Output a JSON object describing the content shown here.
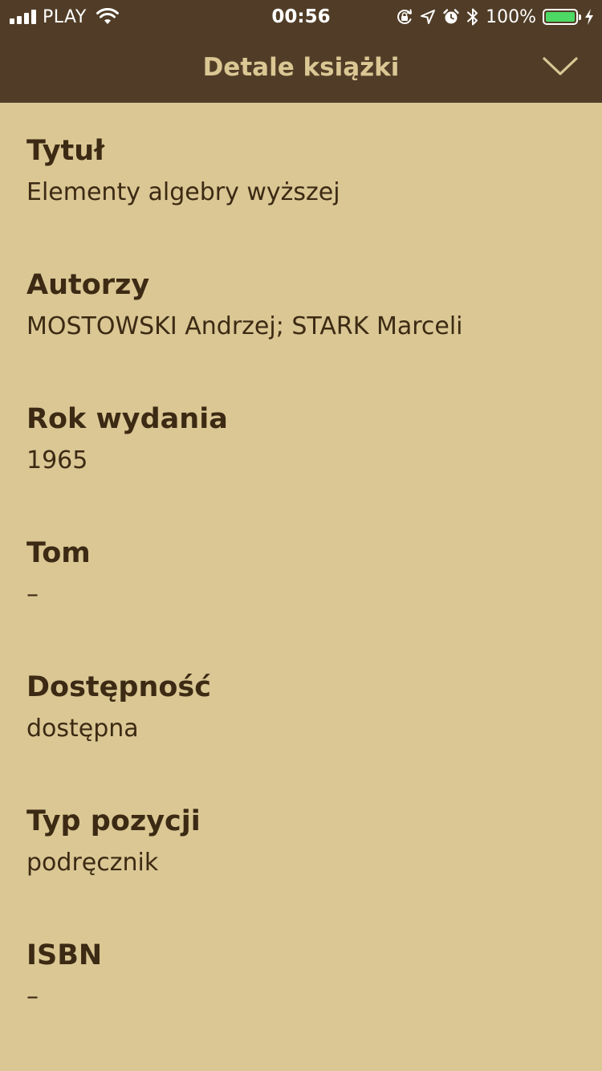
{
  "status_bar": {
    "carrier": "PLAY",
    "time": "00:56",
    "battery": "100%",
    "battery_level": 1.0
  },
  "header": {
    "title": "Detale książki",
    "collapse_icon": "chevron-down-icon"
  },
  "details": [
    {
      "label": "Tytuł",
      "value": "Elementy algebry wyższej"
    },
    {
      "label": "Autorzy",
      "value": "MOSTOWSKI Andrzej; STARK Marceli"
    },
    {
      "label": "Rok wydania",
      "value": "1965"
    },
    {
      "label": "Tom",
      "value": "–"
    },
    {
      "label": "Dostępność",
      "value": "dostępna"
    },
    {
      "label": "Typ pozycji",
      "value": "podręcznik"
    },
    {
      "label": "ISBN",
      "value": "–"
    }
  ],
  "colors": {
    "header_bg": "#513d27",
    "page_bg": "#dac794",
    "title_text": "#dac794",
    "body_text": "#3c2a14",
    "battery_fill": "#4cd964"
  }
}
